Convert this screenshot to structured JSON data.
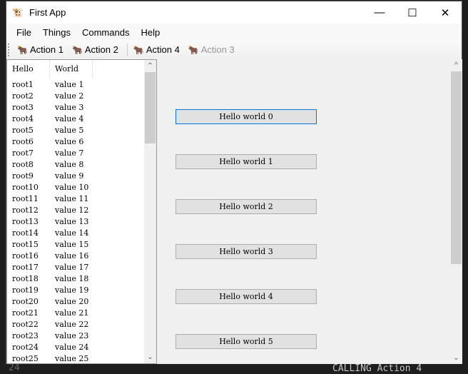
{
  "window": {
    "title": "First App",
    "icon": "app-icon"
  },
  "menu": [
    "File",
    "Things",
    "Commands",
    "Help"
  ],
  "toolbar": [
    {
      "label": "Action 1",
      "enabled": true
    },
    {
      "label": "Action 2",
      "enabled": true
    },
    {
      "label": "Action 4",
      "enabled": true
    },
    {
      "label": "Action 3",
      "enabled": false
    }
  ],
  "tree": {
    "headers": [
      "Hello",
      "World"
    ],
    "rows": [
      [
        "root1",
        "value 1"
      ],
      [
        "root2",
        "value 2"
      ],
      [
        "root3",
        "value 3"
      ],
      [
        "root4",
        "value 4"
      ],
      [
        "root5",
        "value 5"
      ],
      [
        "root6",
        "value 6"
      ],
      [
        "root7",
        "value 7"
      ],
      [
        "root8",
        "value 8"
      ],
      [
        "root9",
        "value 9"
      ],
      [
        "root10",
        "value 10"
      ],
      [
        "root11",
        "value 11"
      ],
      [
        "root12",
        "value 12"
      ],
      [
        "root13",
        "value 13"
      ],
      [
        "root14",
        "value 14"
      ],
      [
        "root15",
        "value 15"
      ],
      [
        "root16",
        "value 16"
      ],
      [
        "root17",
        "value 17"
      ],
      [
        "root18",
        "value 18"
      ],
      [
        "root19",
        "value 19"
      ],
      [
        "root20",
        "value 20"
      ],
      [
        "root21",
        "value 21"
      ],
      [
        "root22",
        "value 22"
      ],
      [
        "root23",
        "value 23"
      ],
      [
        "root24",
        "value 24"
      ],
      [
        "root25",
        "value 25"
      ]
    ]
  },
  "buttons": [
    "Hello world 0",
    "Hello world 1",
    "Hello world 2",
    "Hello world 3",
    "Hello world 4",
    "Hello world 5"
  ],
  "background": {
    "line_number": "24",
    "console_text": "CALLING Action 4"
  }
}
